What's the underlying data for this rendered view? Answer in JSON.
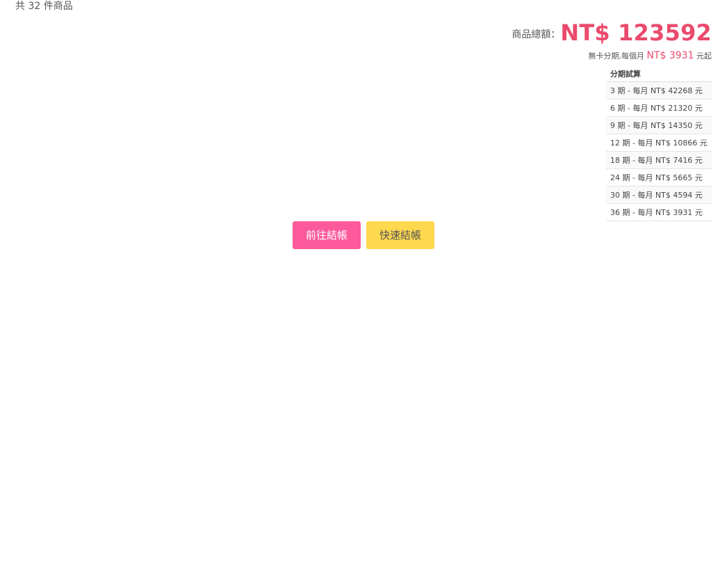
{
  "cart": {
    "item_count_text": "共 32 件商品",
    "total_label": "商品總額：",
    "total_amount": "NT$ 123592"
  },
  "installment": {
    "note_prefix": "無卡分期,每個月",
    "note_amount": "NT$ 3931",
    "note_suffix": "元起",
    "table_header": "分期試算",
    "rows": [
      "3 期 - 每月 NT$ 42268 元",
      "6 期 - 每月 NT$ 21320 元",
      "9 期 - 每月 NT$ 14350 元",
      "12 期 - 每月 NT$ 10866 元",
      "18 期 - 每月 NT$ 7416 元",
      "24 期 - 每月 NT$ 5665 元",
      "30 期 - 每月 NT$ 4594 元",
      "36 期 - 每月 NT$ 3931 元"
    ]
  },
  "actions": {
    "checkout_label": "前往結帳",
    "quick_checkout_label": "快速結帳"
  },
  "colors": {
    "price_accent": "#ea4a6d",
    "checkout_button": "#fc5a9b",
    "quick_checkout_button": "#fed84e"
  }
}
